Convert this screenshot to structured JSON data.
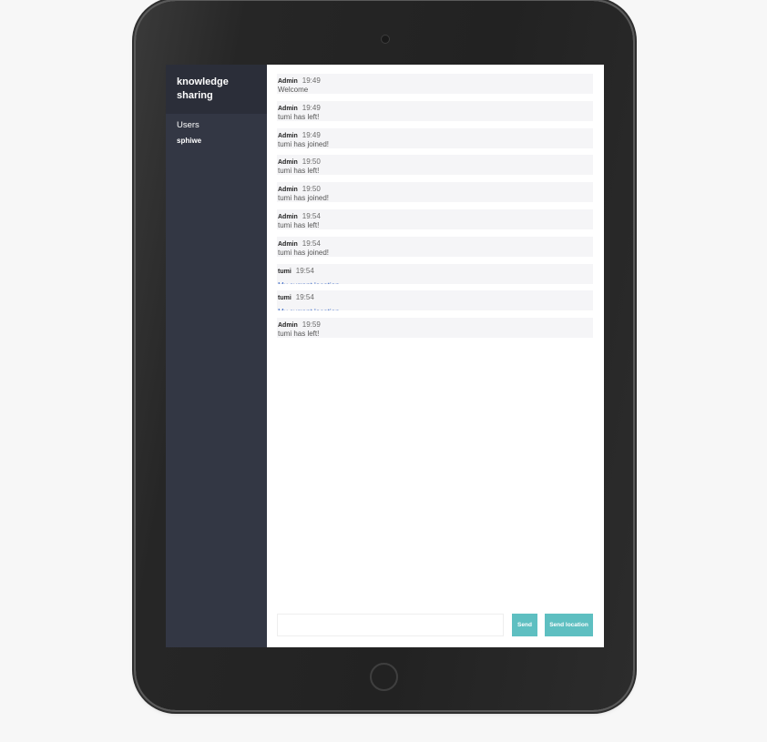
{
  "sidebar": {
    "room_title": "knowledge sharing",
    "users_heading": "Users",
    "users": [
      "sphiwe"
    ]
  },
  "messages": [
    {
      "name": "Admin",
      "time": "19:49",
      "text": "Welcome",
      "is_link": false
    },
    {
      "name": "Admin",
      "time": "19:49",
      "text": "tumi has left!",
      "is_link": false
    },
    {
      "name": "Admin",
      "time": "19:49",
      "text": "tumi has joined!",
      "is_link": false
    },
    {
      "name": "Admin",
      "time": "19:50",
      "text": "tumi has left!",
      "is_link": false
    },
    {
      "name": "Admin",
      "time": "19:50",
      "text": "tumi has joined!",
      "is_link": false
    },
    {
      "name": "Admin",
      "time": "19:54",
      "text": "tumi has left!",
      "is_link": false
    },
    {
      "name": "Admin",
      "time": "19:54",
      "text": "tumi has joined!",
      "is_link": false
    },
    {
      "name": "tumi",
      "time": "19:54",
      "text": "My current location",
      "is_link": true
    },
    {
      "name": "tumi",
      "time": "19:54",
      "text": "My current location",
      "is_link": true
    },
    {
      "name": "Admin",
      "time": "19:59",
      "text": "tumi has left!",
      "is_link": false
    }
  ],
  "composer": {
    "input_value": "",
    "input_placeholder": "",
    "send_label": "Send",
    "send_location_label": "Send location"
  },
  "colors": {
    "sidebar_bg": "#333744",
    "sidebar_header_bg": "#2b2e39",
    "button_accent": "#5ebfc1",
    "link": "#4a74c9",
    "message_bg": "#f5f5f7"
  },
  "icons": {
    "camera": "camera-icon",
    "home_button": "home-button"
  }
}
